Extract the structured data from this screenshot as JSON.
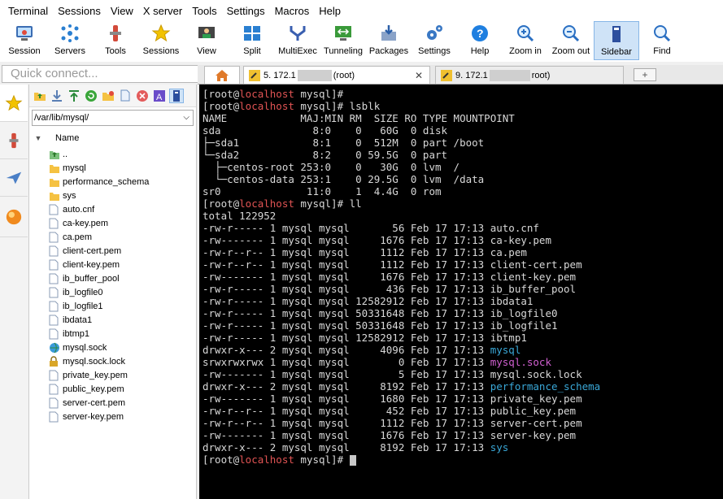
{
  "menu": [
    "Terminal",
    "Sessions",
    "View",
    "X server",
    "Tools",
    "Settings",
    "Macros",
    "Help"
  ],
  "toolbar": [
    {
      "label": "Session",
      "icon": "session-icon"
    },
    {
      "label": "Servers",
      "icon": "servers-icon"
    },
    {
      "label": "Tools",
      "icon": "tools-icon"
    },
    {
      "label": "Sessions",
      "icon": "sessions-star-icon"
    },
    {
      "label": "View",
      "icon": "view-icon"
    },
    {
      "label": "Split",
      "icon": "split-icon"
    },
    {
      "label": "MultiExec",
      "icon": "multiexec-icon"
    },
    {
      "label": "Tunneling",
      "icon": "tunneling-icon"
    },
    {
      "label": "Packages",
      "icon": "packages-icon"
    },
    {
      "label": "Settings",
      "icon": "settings-icon"
    },
    {
      "label": "Help",
      "icon": "help-icon"
    },
    {
      "label": "Zoom in",
      "icon": "zoom-in-icon"
    },
    {
      "label": "Zoom out",
      "icon": "zoom-out-icon"
    },
    {
      "label": "Sidebar",
      "icon": "sidebar-icon"
    },
    {
      "label": "Find",
      "icon": "find-icon"
    }
  ],
  "quick_connect": {
    "placeholder": "Quick connect..."
  },
  "sidebar": {
    "path": "/var/lib/mysql/",
    "column_name": "Name",
    "files": [
      {
        "name": "..",
        "type": "up"
      },
      {
        "name": "mysql",
        "type": "folder"
      },
      {
        "name": "performance_schema",
        "type": "folder"
      },
      {
        "name": "sys",
        "type": "folder"
      },
      {
        "name": "auto.cnf",
        "type": "file"
      },
      {
        "name": "ca-key.pem",
        "type": "file"
      },
      {
        "name": "ca.pem",
        "type": "file"
      },
      {
        "name": "client-cert.pem",
        "type": "file"
      },
      {
        "name": "client-key.pem",
        "type": "file"
      },
      {
        "name": "ib_buffer_pool",
        "type": "file"
      },
      {
        "name": "ib_logfile0",
        "type": "file"
      },
      {
        "name": "ib_logfile1",
        "type": "file"
      },
      {
        "name": "ibdata1",
        "type": "file"
      },
      {
        "name": "ibtmp1",
        "type": "file"
      },
      {
        "name": "mysql.sock",
        "type": "socket"
      },
      {
        "name": "mysql.sock.lock",
        "type": "lock"
      },
      {
        "name": "private_key.pem",
        "type": "file"
      },
      {
        "name": "public_key.pem",
        "type": "file"
      },
      {
        "name": "server-cert.pem",
        "type": "file"
      },
      {
        "name": "server-key.pem",
        "type": "file"
      }
    ]
  },
  "tabs": [
    {
      "prefix": "5. 172.1",
      "suffix": "(root)",
      "active": true
    },
    {
      "prefix": "9. 172.1",
      "suffix": "root)",
      "active": false
    }
  ],
  "terminal": {
    "prompt_user": "[root@",
    "prompt_host": "localhost",
    "prompt_rest": " mysql]# ",
    "lines": [
      {
        "kind": "prompt",
        "cmd": ""
      },
      {
        "kind": "prompt",
        "cmd": "lsblk"
      },
      {
        "kind": "text",
        "text": "NAME            MAJ:MIN RM  SIZE RO TYPE MOUNTPOINT"
      },
      {
        "kind": "text",
        "text": "sda               8:0    0   60G  0 disk"
      },
      {
        "kind": "text",
        "text": "├─sda1            8:1    0  512M  0 part /boot"
      },
      {
        "kind": "text",
        "text": "└─sda2            8:2    0 59.5G  0 part"
      },
      {
        "kind": "text",
        "text": "  ├─centos-root 253:0    0   30G  0 lvm  /"
      },
      {
        "kind": "text",
        "text": "  └─centos-data 253:1    0 29.5G  0 lvm  /data"
      },
      {
        "kind": "text",
        "text": "sr0              11:0    1  4.4G  0 rom"
      },
      {
        "kind": "prompt",
        "cmd": "ll"
      },
      {
        "kind": "text",
        "text": "total 122952"
      },
      {
        "kind": "ls",
        "text": "-rw-r----- 1 mysql mysql       56 Feb 17 17:13 ",
        "name": "auto.cnf",
        "color": "normal"
      },
      {
        "kind": "ls",
        "text": "-rw------- 1 mysql mysql     1676 Feb 17 17:13 ",
        "name": "ca-key.pem",
        "color": "normal"
      },
      {
        "kind": "ls",
        "text": "-rw-r--r-- 1 mysql mysql     1112 Feb 17 17:13 ",
        "name": "ca.pem",
        "color": "normal"
      },
      {
        "kind": "ls",
        "text": "-rw-r--r-- 1 mysql mysql     1112 Feb 17 17:13 ",
        "name": "client-cert.pem",
        "color": "normal"
      },
      {
        "kind": "ls",
        "text": "-rw------- 1 mysql mysql     1676 Feb 17 17:13 ",
        "name": "client-key.pem",
        "color": "normal"
      },
      {
        "kind": "ls",
        "text": "-rw-r----- 1 mysql mysql      436 Feb 17 17:13 ",
        "name": "ib_buffer_pool",
        "color": "normal"
      },
      {
        "kind": "ls",
        "text": "-rw-r----- 1 mysql mysql 12582912 Feb 17 17:13 ",
        "name": "ibdata1",
        "color": "normal"
      },
      {
        "kind": "ls",
        "text": "-rw-r----- 1 mysql mysql 50331648 Feb 17 17:13 ",
        "name": "ib_logfile0",
        "color": "normal"
      },
      {
        "kind": "ls",
        "text": "-rw-r----- 1 mysql mysql 50331648 Feb 17 17:13 ",
        "name": "ib_logfile1",
        "color": "normal"
      },
      {
        "kind": "ls",
        "text": "-rw-r----- 1 mysql mysql 12582912 Feb 17 17:13 ",
        "name": "ibtmp1",
        "color": "normal"
      },
      {
        "kind": "ls",
        "text": "drwxr-x--- 2 mysql mysql     4096 Feb 17 17:13 ",
        "name": "mysql",
        "color": "dir"
      },
      {
        "kind": "ls",
        "text": "srwxrwxrwx 1 mysql mysql        0 Feb 17 17:13 ",
        "name": "mysql.sock",
        "color": "sock"
      },
      {
        "kind": "ls",
        "text": "-rw------- 1 mysql mysql        5 Feb 17 17:13 ",
        "name": "mysql.sock.lock",
        "color": "normal"
      },
      {
        "kind": "ls",
        "text": "drwxr-x--- 2 mysql mysql     8192 Feb 17 17:13 ",
        "name": "performance_schema",
        "color": "dir"
      },
      {
        "kind": "ls",
        "text": "-rw------- 1 mysql mysql     1680 Feb 17 17:13 ",
        "name": "private_key.pem",
        "color": "normal"
      },
      {
        "kind": "ls",
        "text": "-rw-r--r-- 1 mysql mysql      452 Feb 17 17:13 ",
        "name": "public_key.pem",
        "color": "normal"
      },
      {
        "kind": "ls",
        "text": "-rw-r--r-- 1 mysql mysql     1112 Feb 17 17:13 ",
        "name": "server-cert.pem",
        "color": "normal"
      },
      {
        "kind": "ls",
        "text": "-rw------- 1 mysql mysql     1676 Feb 17 17:13 ",
        "name": "server-key.pem",
        "color": "normal"
      },
      {
        "kind": "ls",
        "text": "drwxr-x--- 2 mysql mysql     8192 Feb 17 17:13 ",
        "name": "sys",
        "color": "dir"
      },
      {
        "kind": "prompt",
        "cmd": "",
        "cursor": true
      }
    ]
  },
  "colors": {
    "terminal_bg": "#000000",
    "prompt_host": "#e05353",
    "dir": "#3aa8d8",
    "socket": "#d05fd0"
  }
}
